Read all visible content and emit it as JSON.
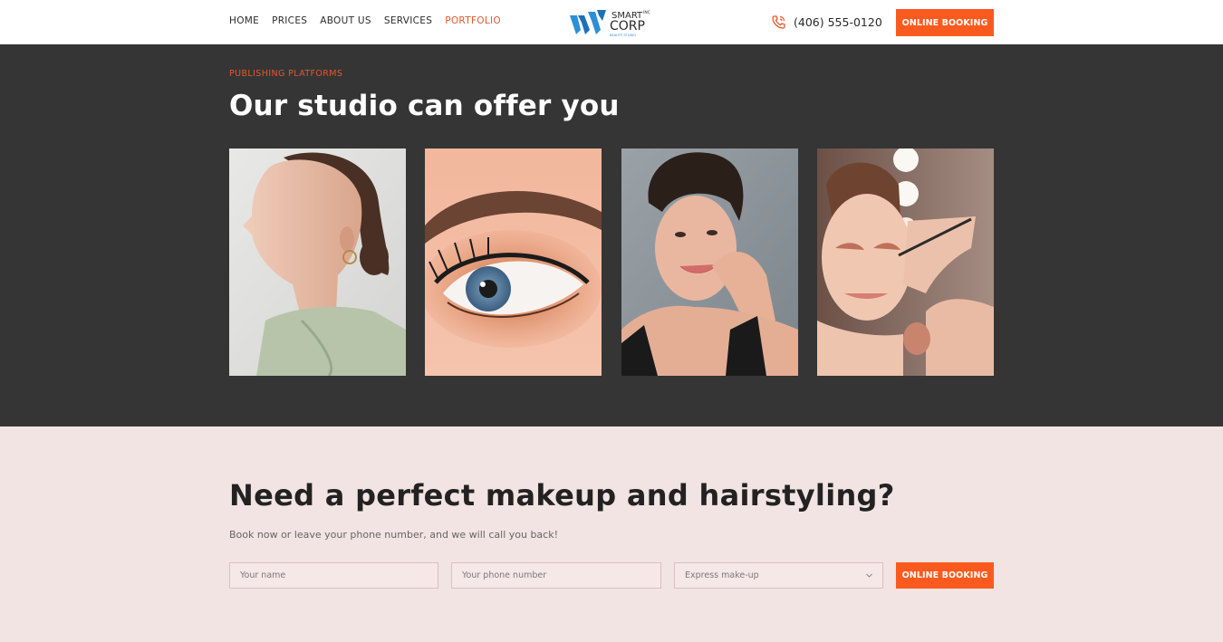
{
  "nav": {
    "items": [
      {
        "label": "HOME",
        "active": false
      },
      {
        "label": "PRICES",
        "active": false
      },
      {
        "label": "ABOUT US",
        "active": false
      },
      {
        "label": "SERVICES",
        "active": false
      },
      {
        "label": "PORTFOLIO",
        "active": true
      }
    ]
  },
  "logo": {
    "line1": "SMART",
    "line2": "CORP",
    "badge": "INC",
    "tagline": "BEAUTY STUDIO",
    "icon": "w-logo-icon"
  },
  "header": {
    "phone": "(406) 555-0120",
    "phone_icon": "phone-ringing-icon",
    "booking_label": "ONLINE BOOKING"
  },
  "portfolio": {
    "eyebrow": "PUBLISHING PLATFORMS",
    "title": "Our studio can offer you",
    "cards": [
      {
        "alt": "portrait-profile-photo"
      },
      {
        "alt": "eye-makeup-closeup-photo"
      },
      {
        "alt": "smiling-woman-photo"
      },
      {
        "alt": "makeup-application-photo"
      }
    ]
  },
  "cta": {
    "title": "Need a perfect makeup and hairstyling?",
    "subtitle": "Book now or leave your phone number, and we will call you back!",
    "name_placeholder": "Your name",
    "phone_placeholder": "Your phone number",
    "service_selected": "Express make-up",
    "button_label": "ONLINE BOOKING"
  },
  "colors": {
    "accent": "#fb5a1f",
    "dark_bg": "#353535",
    "light_bg": "#f2e4e2"
  }
}
